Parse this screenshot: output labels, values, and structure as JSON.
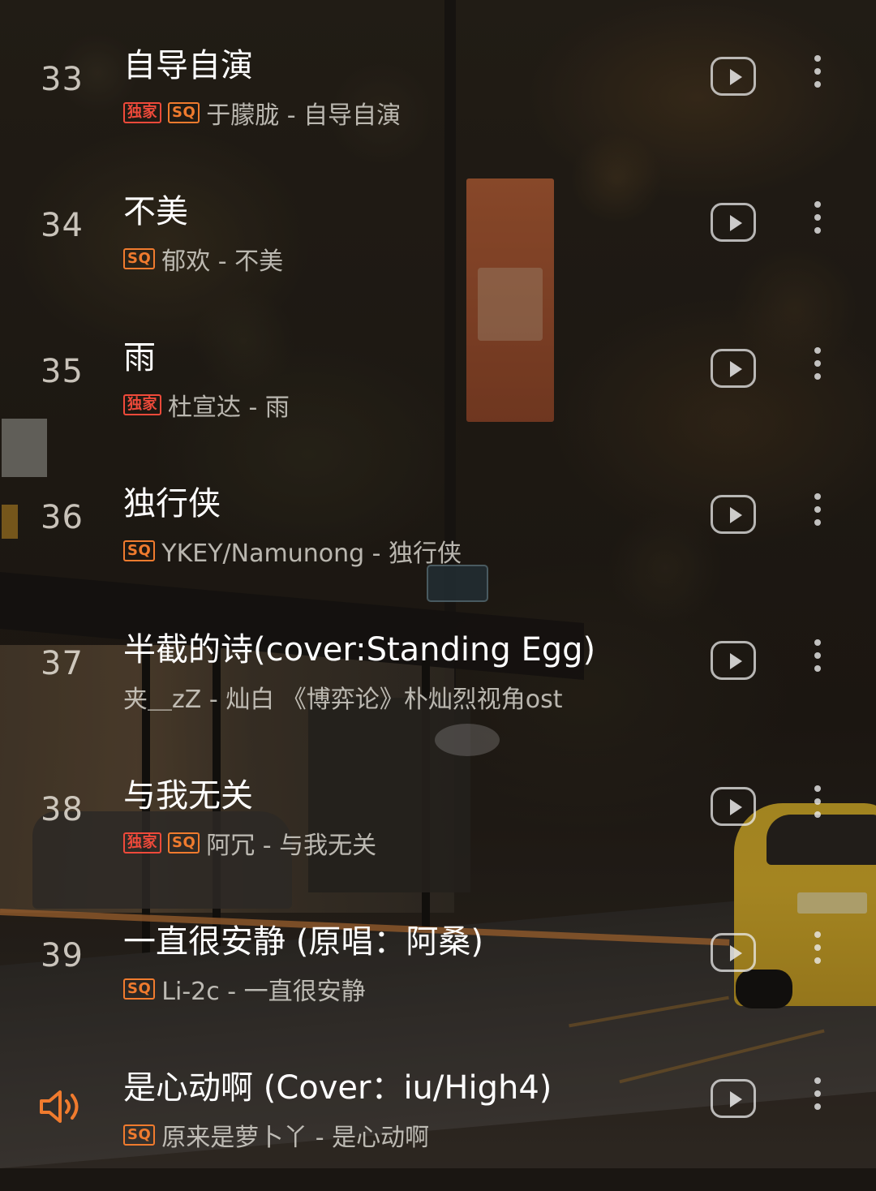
{
  "songs": [
    {
      "index": "33",
      "title": "自导自演",
      "artist_album": "于朦胧 - 自导自演",
      "tags": [
        "独家",
        "SQ"
      ],
      "playing": false
    },
    {
      "index": "34",
      "title": "不美",
      "artist_album": "郁欢 - 不美",
      "tags": [
        "SQ"
      ],
      "playing": false
    },
    {
      "index": "35",
      "title": "雨",
      "artist_album": "杜宣达 - 雨",
      "tags": [
        "独家"
      ],
      "playing": false
    },
    {
      "index": "36",
      "title": "独行侠",
      "artist_album": "YKEY/Namunong - 独行侠",
      "tags": [
        "SQ"
      ],
      "playing": false
    },
    {
      "index": "37",
      "title": "半截的诗(cover:Standing Egg)",
      "artist_album": "夹＿zZ - 灿白 《博弈论》朴灿烈视角ost",
      "tags": [],
      "playing": false
    },
    {
      "index": "38",
      "title": "与我无关",
      "artist_album": "阿冗 - 与我无关",
      "tags": [
        "独家",
        "SQ"
      ],
      "playing": false
    },
    {
      "index": "39",
      "title": "一直很安静 (原唱：阿桑)",
      "artist_album": "Li-2c - 一直很安静",
      "tags": [
        "SQ"
      ],
      "playing": false
    },
    {
      "index": "",
      "title": "是心动啊 (Cover：iu/High4)",
      "artist_album": "原来是萝卜丫 - 是心动啊",
      "tags": [
        "SQ"
      ],
      "playing": true
    }
  ],
  "icons": {
    "play": "play-icon",
    "more": "more-vertical-icon",
    "now_playing": "speaker-icon"
  },
  "colors": {
    "exclusive_tag": "#ef4a3a",
    "sq_tag": "#f07b2e",
    "now_playing": "#f07b2e"
  }
}
